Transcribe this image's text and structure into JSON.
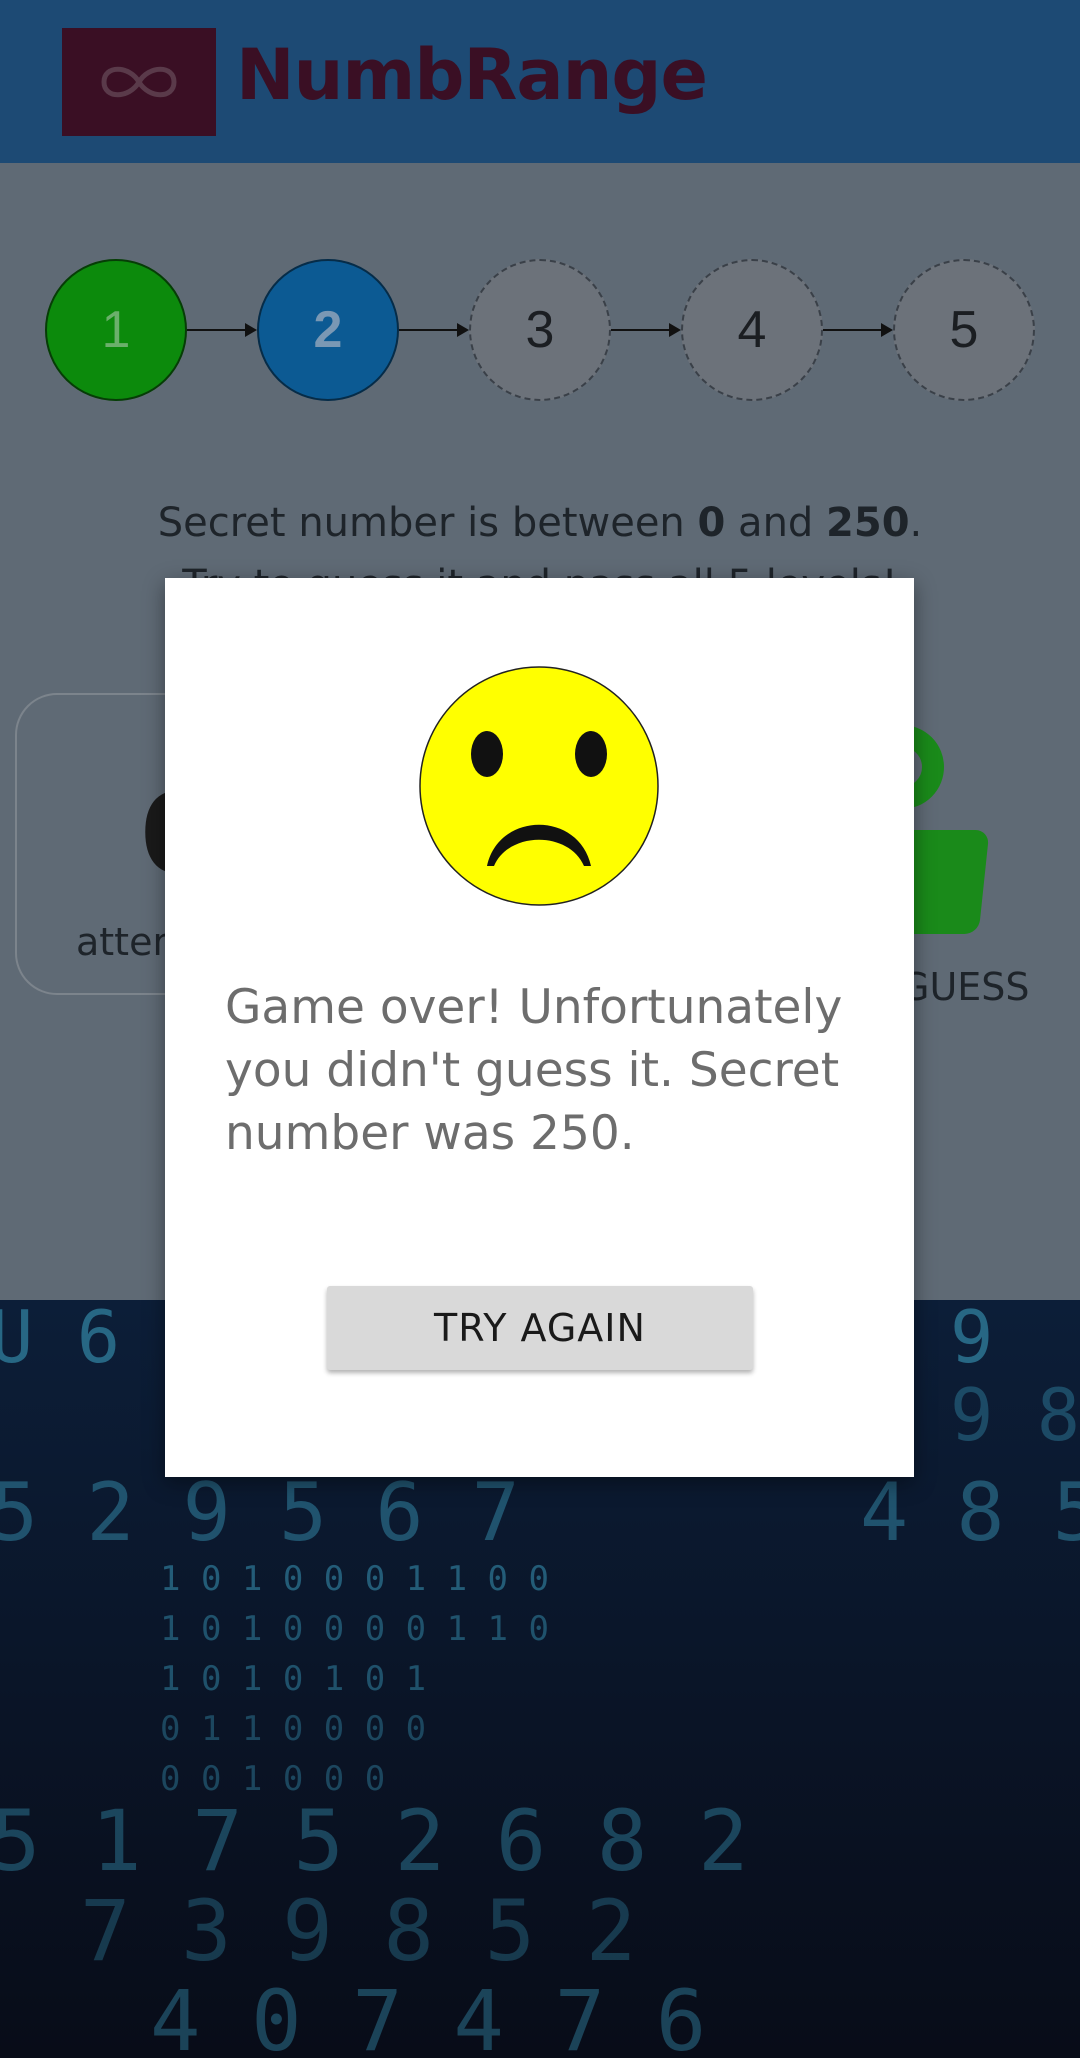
{
  "header": {
    "app_title": "NumbRange",
    "logo_icon": "infinity-icon"
  },
  "steps": [
    {
      "label": "1",
      "state": "done"
    },
    {
      "label": "2",
      "state": "current"
    },
    {
      "label": "3",
      "state": "pending"
    },
    {
      "label": "4",
      "state": "pending"
    },
    {
      "label": "5",
      "state": "pending"
    }
  ],
  "range": {
    "prefix": "Secret number is between ",
    "min": "0",
    "middle": " and ",
    "max": "250",
    "suffix": "."
  },
  "hint": "Try to guess it and pass all 5 levels!",
  "stats": {
    "attempts_value": "0",
    "attempts_label": "attempts",
    "guess_label": "GUESS",
    "guess_icon": "user-icon"
  },
  "dialog": {
    "icon": "sad-face-icon",
    "message": "Game over! Unfortunately you didn't guess it. Secret number was 250.",
    "button_label": "TRY AGAIN"
  },
  "colors": {
    "header_bg": "#1d4a74",
    "step_done": "#0c8a0c",
    "step_current": "#0c5a93",
    "face_yellow": "#ffff00"
  }
}
